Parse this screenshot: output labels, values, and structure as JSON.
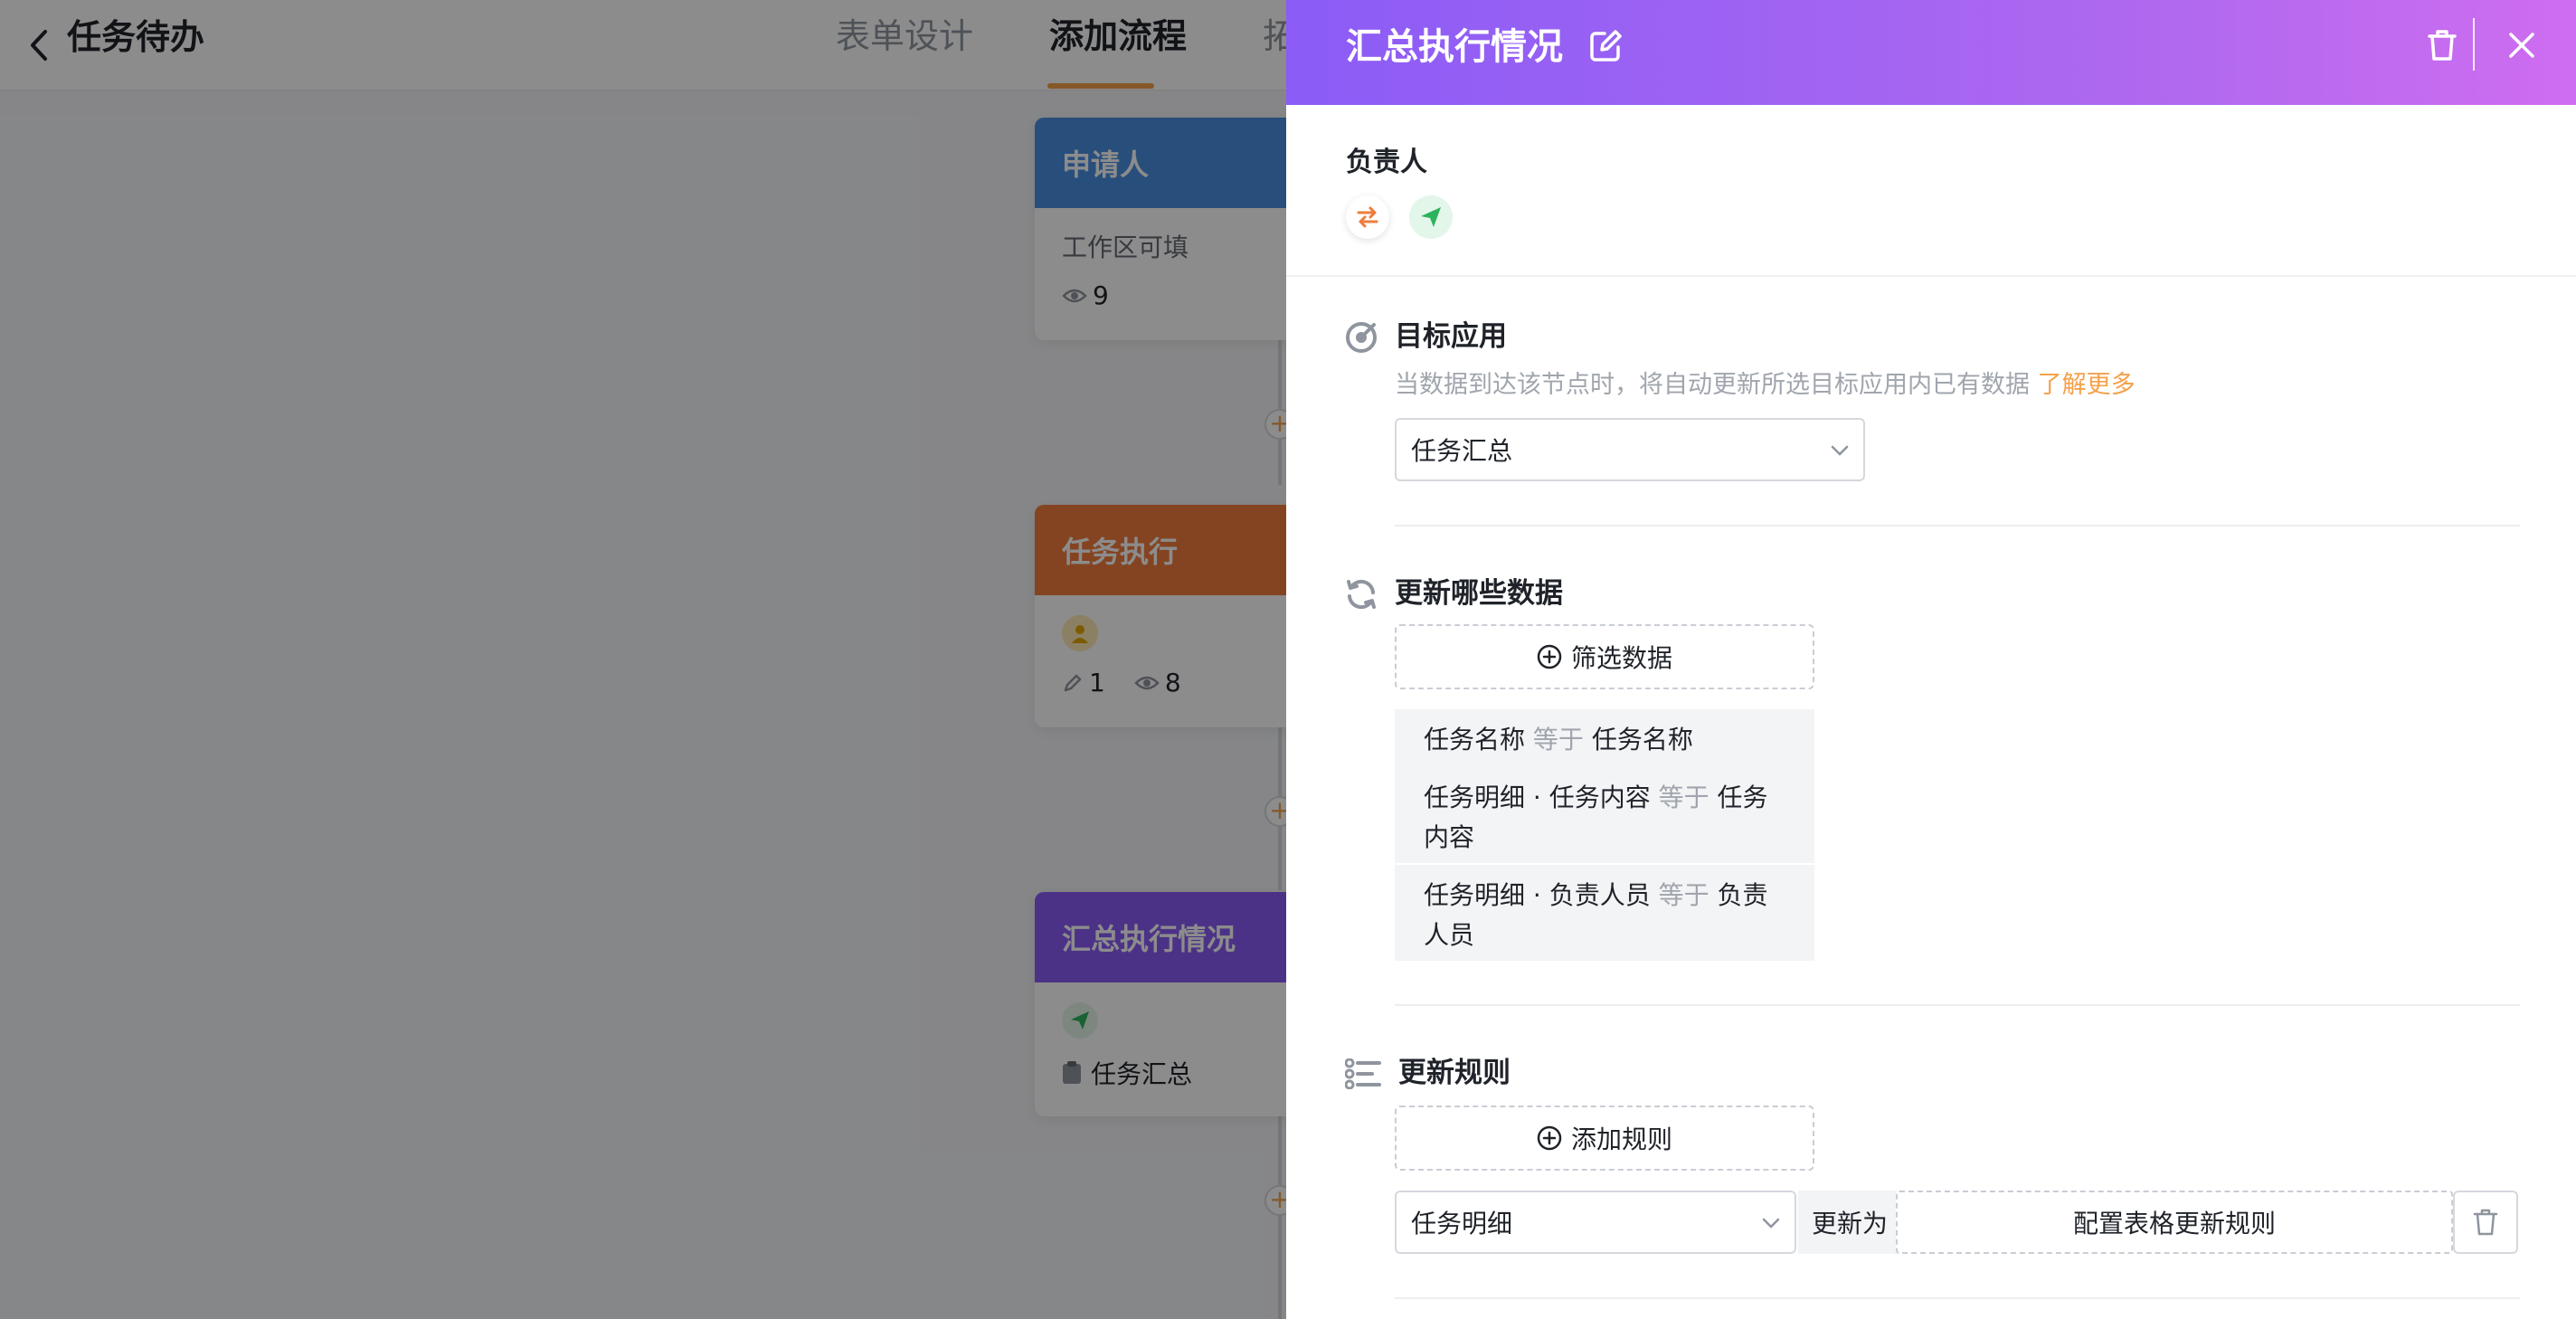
{
  "app": {
    "title": "任务待办",
    "tabs": [
      {
        "label": "表单设计",
        "active": false
      },
      {
        "label": "添加流程",
        "active": true
      },
      {
        "label": "拓",
        "active": false
      }
    ]
  },
  "flow": {
    "nodes": [
      {
        "title": "申请人",
        "color": "#4a90e2",
        "body_text": "工作区可填",
        "views": "9"
      },
      {
        "title": "任务执行",
        "color": "#f07c3c",
        "edits": "1",
        "views": "8"
      },
      {
        "title": "汇总执行情况",
        "color": "#8b5cf6",
        "target_text": "任务汇总"
      }
    ]
  },
  "drawer": {
    "title": "汇总执行情况",
    "header_gradient": [
      "#8b5cf6",
      "#cf6df0"
    ],
    "assignee_label": "负责人",
    "target_section": {
      "title": "目标应用",
      "hint": "当数据到达该节点时，将自动更新所选目标应用内已有数据",
      "learn_more": "了解更多",
      "selected_app": "任务汇总"
    },
    "data_section": {
      "title": "更新哪些数据",
      "filter_button": "筛选数据",
      "conditions": [
        {
          "field": "任务名称",
          "op": "等于",
          "value": "任务名称"
        },
        {
          "field": "任务明细 · 任务内容",
          "op": "等于",
          "value": "任务内容"
        },
        {
          "field": "任务明细 · 负责人员",
          "op": "等于",
          "value": "负责人员"
        }
      ]
    },
    "rules_section": {
      "title": "更新规则",
      "add_button": "添加规则",
      "rule_field": "任务明细",
      "update_to": "更新为",
      "config_button": "配置表格更新规则"
    }
  },
  "colors": {
    "accent": "#f5a04a",
    "success": "#2db35d",
    "brand": "#8b5cf6"
  }
}
